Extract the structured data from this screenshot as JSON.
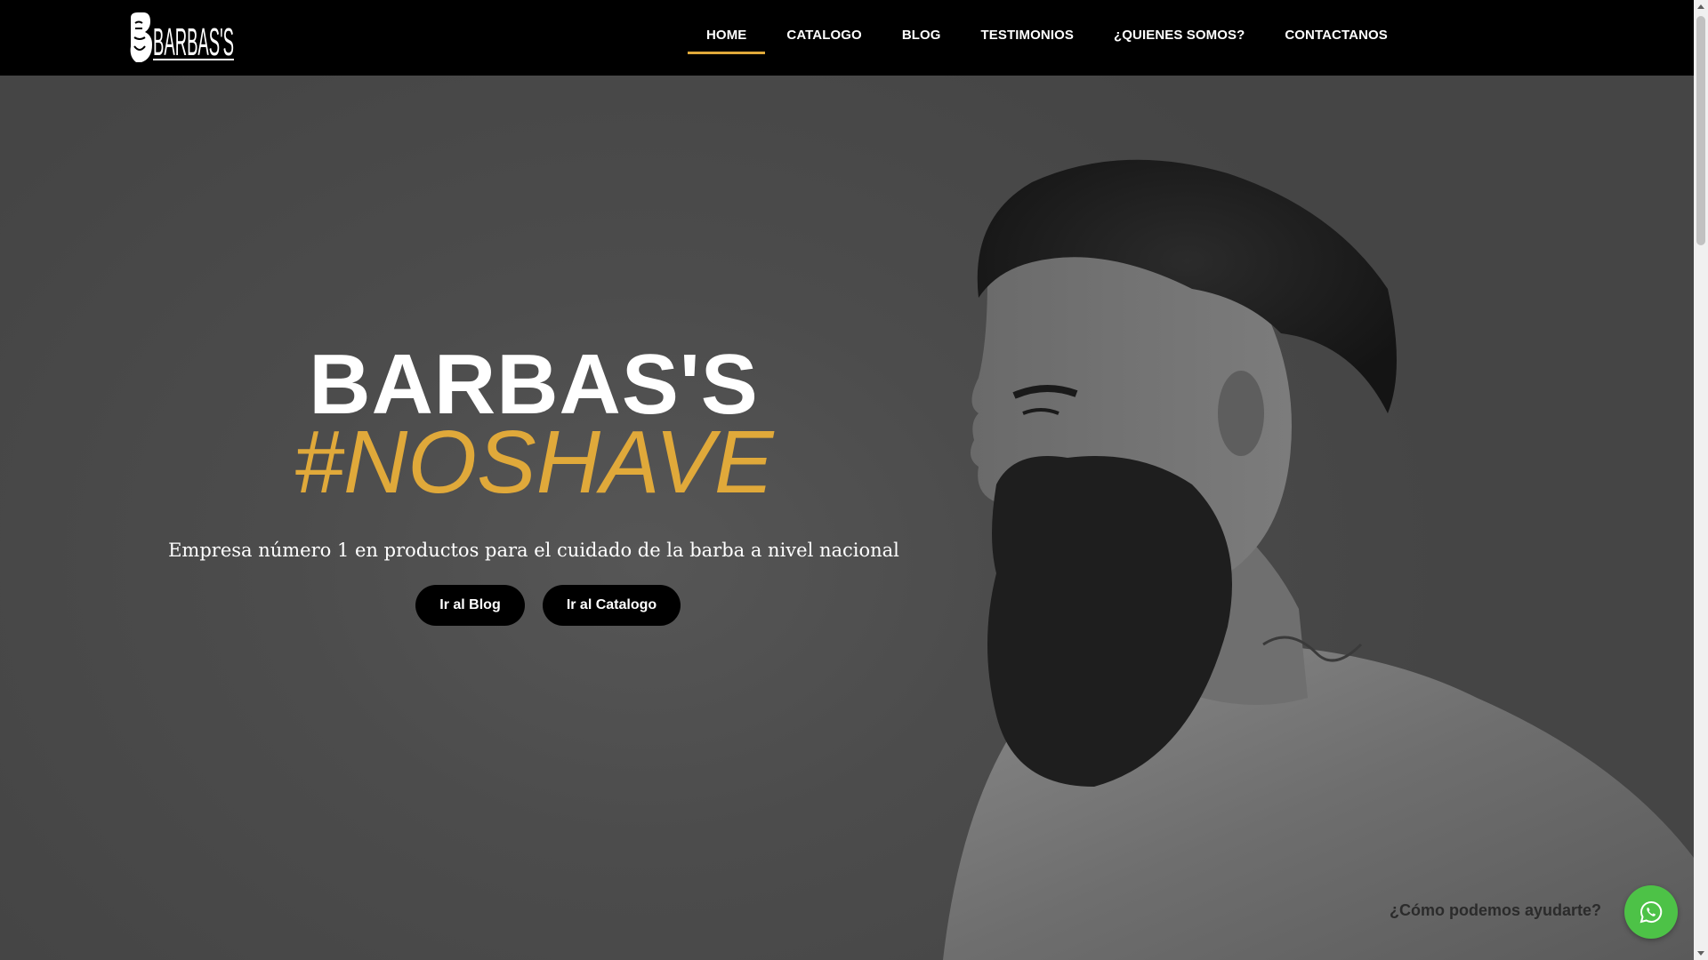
{
  "header": {
    "logo_text": "BARBAS'S",
    "nav": [
      {
        "label": "HOME",
        "active": true
      },
      {
        "label": "CATALOGO",
        "active": false
      },
      {
        "label": "BLOG",
        "active": false
      },
      {
        "label": "TESTIMONIOS",
        "active": false
      },
      {
        "label": "¿QUIENES SOMOS?",
        "active": false
      },
      {
        "label": "CONTACTANOS",
        "active": false
      }
    ]
  },
  "hero": {
    "title": "BARBAS'S",
    "tagline": "#NOSHAVE",
    "subtitle": "Empresa número 1 en productos  para el cuidado de la barba a nivel nacional",
    "buttons": {
      "blog": "Ir al Blog",
      "catalogo": "Ir al Catalogo"
    },
    "image_icon": "bearded-man-profile-photo"
  },
  "whatsapp": {
    "prompt": "¿Cómo podemos ayudarte?",
    "icon": "whatsapp-icon",
    "color": "#4dc247"
  },
  "colors": {
    "accent": "#e0a93a",
    "header_bg": "#000000",
    "button_bg": "#000000"
  }
}
